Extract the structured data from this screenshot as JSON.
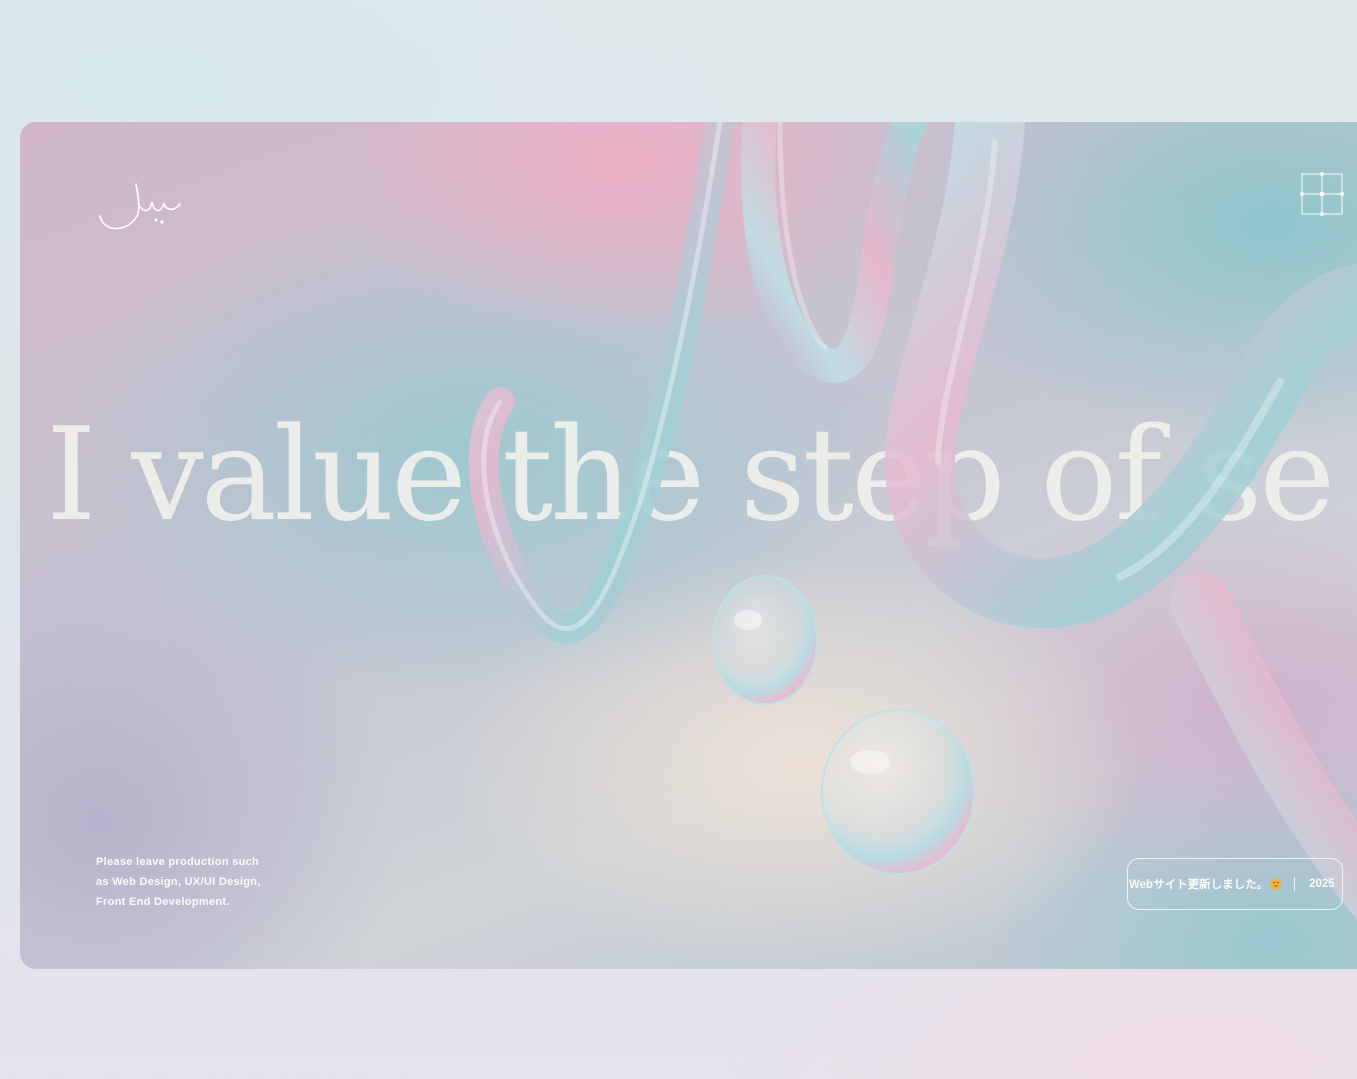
{
  "hero": {
    "headline": "I value the step of se"
  },
  "tagline": {
    "line1": "Please leave production such",
    "line2": "as Web Design, UX/UI Design,",
    "line3": "Front End Development."
  },
  "news": {
    "text": "Webサイト更新しました。",
    "year": "2025"
  },
  "icons": {
    "logo": "signature-logo",
    "menu": "grid-menu-icon",
    "emoji": "smiling-face-emoji"
  },
  "colors": {
    "pink": "#ecb4c8",
    "teal": "#94c8cc",
    "lavender": "#b8b2cc",
    "text_light": "#f0f0ec"
  }
}
